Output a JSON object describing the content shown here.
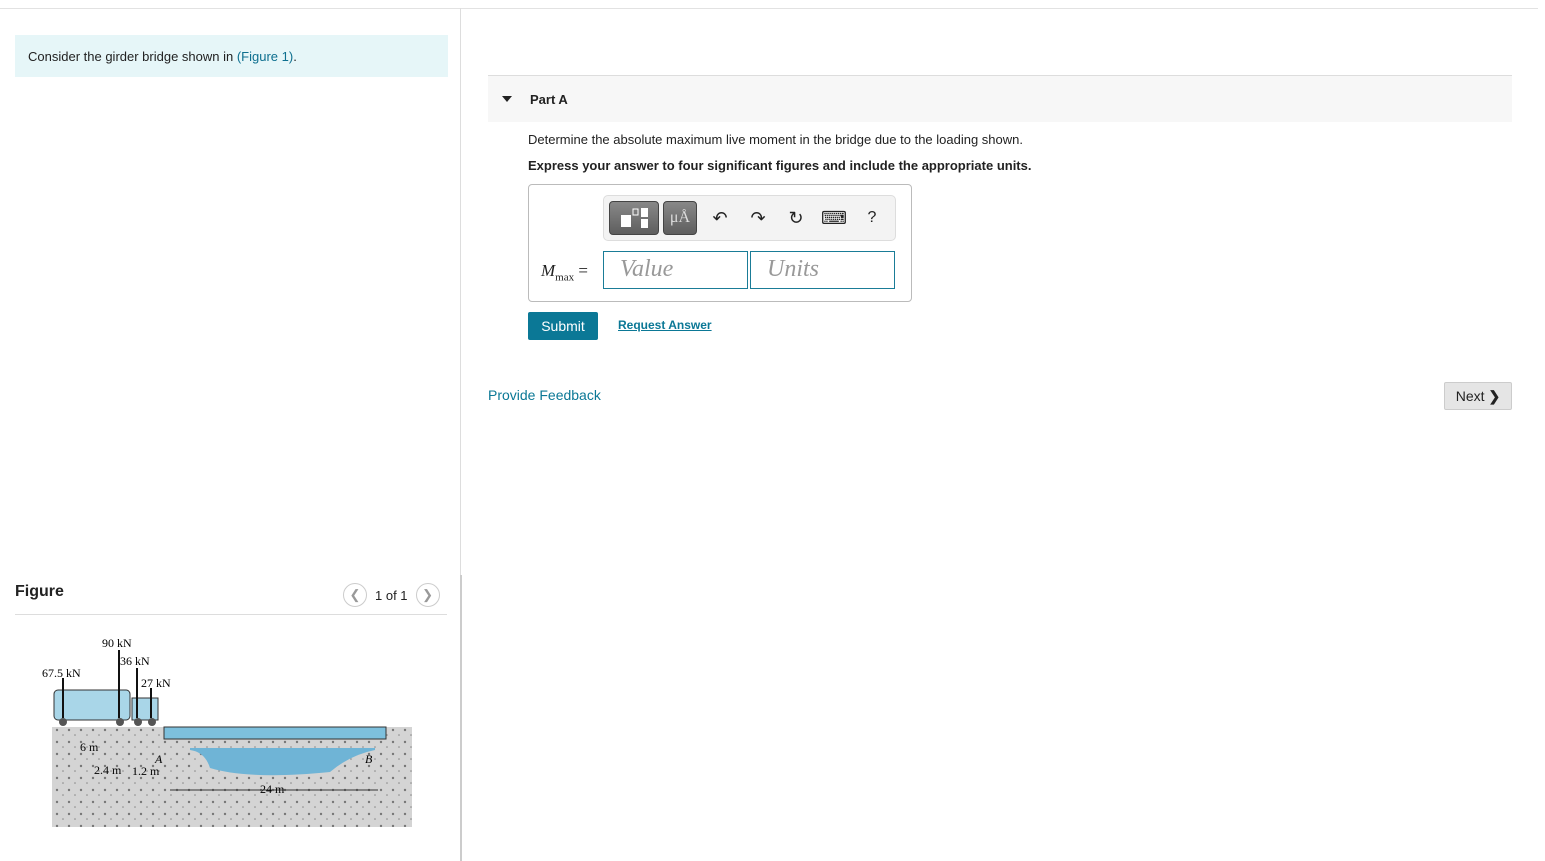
{
  "intro": {
    "text": "Consider the girder bridge shown in ",
    "link": "(Figure 1)",
    "end": "."
  },
  "figure": {
    "title": "Figure",
    "pager": "1 of 1",
    "labels": {
      "load1": "67.5 kN",
      "load2": "90 kN",
      "load3": "36 kN",
      "load4": "27 kN",
      "d1": "6 m",
      "d2": "2.4 m",
      "d3": "1.2 m",
      "span": "24 m",
      "a": "A",
      "b": "B"
    }
  },
  "part": {
    "title": "Part A",
    "question": "Determine the absolute maximum live moment in the bridge due to the loading shown.",
    "instruction": "Express your answer to four significant figures and include the appropriate units."
  },
  "answer": {
    "label_main": "M",
    "label_sub": "max",
    "equals": "=",
    "value_placeholder": "Value",
    "units_placeholder": "Units",
    "units_button": "μÅ",
    "help": "?"
  },
  "actions": {
    "submit": "Submit",
    "request": "Request Answer",
    "feedback": "Provide Feedback",
    "next": "Next"
  },
  "colors": {
    "accent": "#0b7896",
    "intro_bg": "#e6f6f8"
  }
}
